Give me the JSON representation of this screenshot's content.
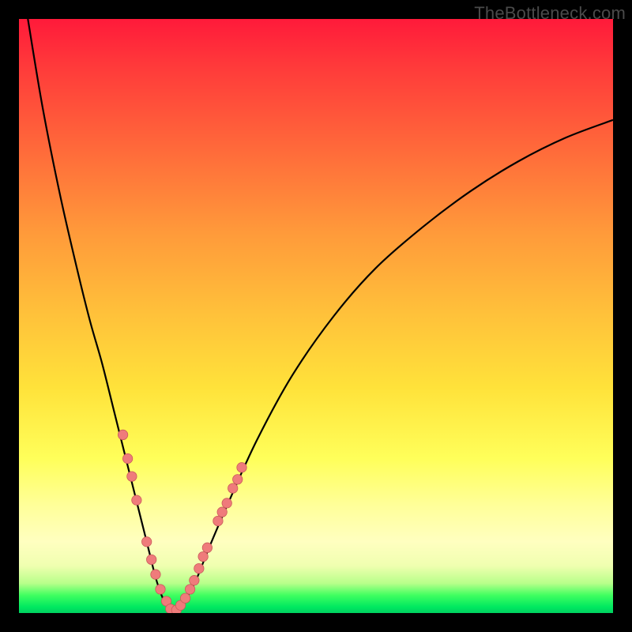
{
  "watermark": "TheBottleneck.com",
  "colors": {
    "frame_bg": "#000000",
    "curve_stroke": "#000000",
    "marker_fill": "#ef7b7b",
    "marker_stroke": "#c95a5a"
  },
  "chart_data": {
    "type": "line",
    "title": "",
    "xlabel": "",
    "ylabel": "",
    "xlim": [
      0,
      100
    ],
    "ylim": [
      0,
      100
    ],
    "grid": false,
    "legend": false,
    "annotations": [
      "TheBottleneck.com"
    ],
    "series": [
      {
        "name": "left-branch",
        "x": [
          1.5,
          4,
          7,
          10,
          12,
          14,
          16,
          17.5,
          19,
          20.5,
          22,
          23,
          24,
          25,
          26
        ],
        "y": [
          100,
          85,
          70,
          57,
          49,
          42,
          34,
          28,
          22,
          16,
          10,
          6,
          3,
          1,
          0
        ]
      },
      {
        "name": "right-branch",
        "x": [
          26,
          27,
          28.5,
          30,
          32,
          35,
          40,
          46,
          53,
          60,
          68,
          76,
          84,
          92,
          100
        ],
        "y": [
          0,
          1,
          3,
          6,
          11,
          18,
          29,
          40,
          50,
          58,
          65,
          71,
          76,
          80,
          83
        ]
      }
    ],
    "markers": [
      {
        "branch": "left",
        "x": 17.5,
        "y": 30
      },
      {
        "branch": "left",
        "x": 18.3,
        "y": 26
      },
      {
        "branch": "left",
        "x": 19.0,
        "y": 23
      },
      {
        "branch": "left",
        "x": 19.8,
        "y": 19
      },
      {
        "branch": "left",
        "x": 21.5,
        "y": 12
      },
      {
        "branch": "left",
        "x": 22.3,
        "y": 9
      },
      {
        "branch": "left",
        "x": 23.0,
        "y": 6.5
      },
      {
        "branch": "left",
        "x": 23.8,
        "y": 4
      },
      {
        "branch": "left",
        "x": 24.8,
        "y": 2
      },
      {
        "branch": "left",
        "x": 25.5,
        "y": 0.7
      },
      {
        "branch": "right",
        "x": 26.5,
        "y": 0.5
      },
      {
        "branch": "right",
        "x": 27.2,
        "y": 1.3
      },
      {
        "branch": "right",
        "x": 28.0,
        "y": 2.5
      },
      {
        "branch": "right",
        "x": 28.8,
        "y": 4
      },
      {
        "branch": "right",
        "x": 29.5,
        "y": 5.5
      },
      {
        "branch": "right",
        "x": 30.3,
        "y": 7.5
      },
      {
        "branch": "right",
        "x": 31.0,
        "y": 9.5
      },
      {
        "branch": "right",
        "x": 31.7,
        "y": 11
      },
      {
        "branch": "right",
        "x": 33.5,
        "y": 15.5
      },
      {
        "branch": "right",
        "x": 34.2,
        "y": 17
      },
      {
        "branch": "right",
        "x": 35.0,
        "y": 18.5
      },
      {
        "branch": "right",
        "x": 36.0,
        "y": 21
      },
      {
        "branch": "right",
        "x": 36.8,
        "y": 22.5
      },
      {
        "branch": "right",
        "x": 37.5,
        "y": 24.5
      }
    ]
  }
}
